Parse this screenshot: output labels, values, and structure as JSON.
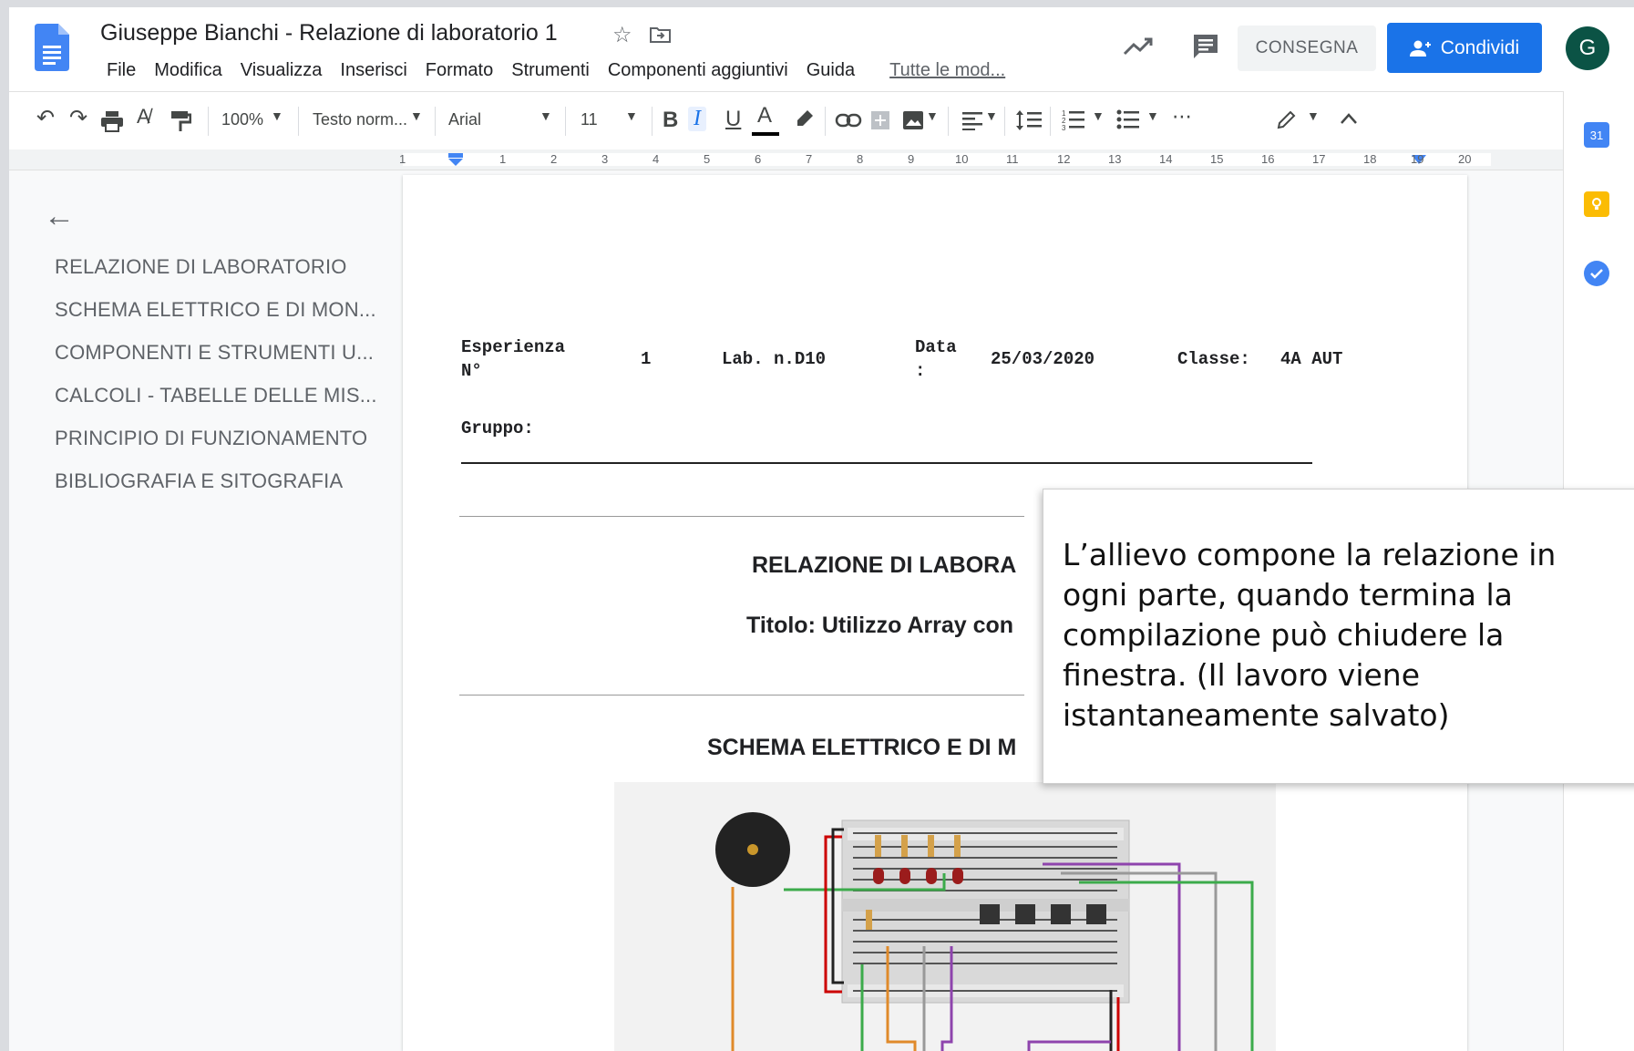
{
  "header": {
    "doc_title": "Giuseppe Bianchi - Relazione di laboratorio 1",
    "menu": [
      "File",
      "Modifica",
      "Visualizza",
      "Inserisci",
      "Formato",
      "Strumenti",
      "Componenti aggiuntivi",
      "Guida"
    ],
    "last_edit": "Tutte le mod...",
    "consegna_label": "CONSEGNA",
    "share_label": "Condividi",
    "avatar_letter": "G"
  },
  "toolbar": {
    "zoom": "100%",
    "style": "Testo norm...",
    "font": "Arial",
    "size": "11",
    "bold": "B",
    "italic": "I",
    "underline": "U",
    "text_color": "A",
    "more": "⋯"
  },
  "ruler": {
    "labels": [
      "1",
      "1",
      "2",
      "3",
      "4",
      "5",
      "6",
      "7",
      "8",
      "9",
      "10",
      "11",
      "12",
      "13",
      "14",
      "15",
      "16",
      "17",
      "18",
      "19",
      "20"
    ]
  },
  "side_panel": {
    "calendar": "31"
  },
  "outline": {
    "items": [
      "RELAZIONE DI LABORATORIO",
      "SCHEMA ELETTRICO E DI MON...",
      "COMPONENTI E STRUMENTI U...",
      "CALCOLI - TABELLE DELLE MIS...",
      "PRINCIPIO DI FUNZIONAMENTO",
      "BIBLIOGRAFIA E SITOGRAFIA"
    ]
  },
  "document": {
    "esperienza_label_1": "Esperienza",
    "esperienza_label_2": "N°",
    "esperienza_value": "1",
    "lab": "Lab. n.D10",
    "data_label_1": "Data",
    "data_label_2": ":",
    "data_value": "25/03/2020",
    "classe_label": "Classe:",
    "classe_value": "4A AUT",
    "gruppo_label": "Gruppo:",
    "heading_relazione": "RELAZIONE DI LABORA",
    "heading_titolo": "Titolo: Utilizzo Array con",
    "heading_schema": "SCHEMA ELETTRICO E DI M"
  },
  "callout": {
    "text": "L’allievo compone la relazione in ogni parte, quando termina la compilazione può chiudere la finestra. (Il lavoro viene istantaneamente salvato)"
  },
  "colors": {
    "accent": "#1a73e8",
    "avatar": "#0b5345",
    "docs_blue": "#4285f4"
  }
}
